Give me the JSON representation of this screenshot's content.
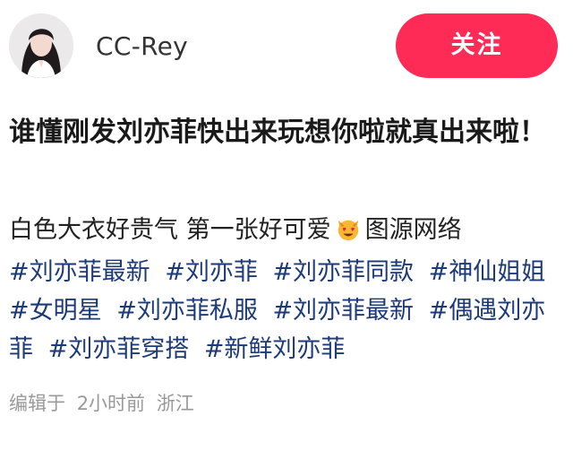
{
  "post": {
    "username": "CC-Rey",
    "follow_label": "关注",
    "title": "谁懂刚发刘亦菲快出来玩想你啦就真出来啦！",
    "text_before_emoji": "白色大衣好贵气 第一张好可爱",
    "emoji": "heart-eyes-cat",
    "text_after_emoji": "图源网络",
    "tags": [
      "#刘亦菲最新",
      "#刘亦菲",
      "#刘亦菲同款",
      "#神仙姐姐",
      "#女明星",
      "#刘亦菲私服",
      "#刘亦菲最新",
      "#偶遇刘亦菲",
      "#刘亦菲穿搭",
      "#新鲜刘亦菲"
    ],
    "meta": {
      "edited_label": "编辑于",
      "time": "2小时前",
      "location": "浙江"
    }
  },
  "colors": {
    "follow_button": "#fd2b55",
    "tag_link": "#1d3a78",
    "meta_text": "#999999"
  }
}
